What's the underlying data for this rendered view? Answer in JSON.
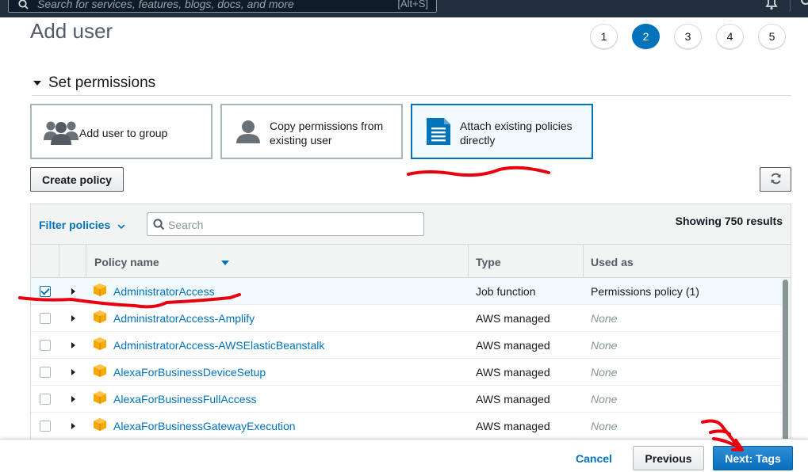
{
  "topbar": {
    "search_placeholder": "Search for services, features, blogs, docs, and more",
    "search_shortcut": "[Alt+S]"
  },
  "page": {
    "title": "Add user",
    "steps": [
      "1",
      "2",
      "3",
      "4",
      "5"
    ],
    "active_step": "2"
  },
  "permissions": {
    "section_title": "Set permissions",
    "options": [
      {
        "label": "Add user to group",
        "icon": "group-icon",
        "selected": false
      },
      {
        "label": "Copy permissions from existing user",
        "icon": "user-icon",
        "selected": false
      },
      {
        "label": "Attach existing policies directly",
        "icon": "document-icon",
        "selected": true
      }
    ]
  },
  "toolbar": {
    "create_policy_label": "Create policy",
    "refresh_icon": "refresh-icon"
  },
  "table": {
    "filter_label": "Filter policies",
    "search_placeholder": "Search",
    "results_count": "Showing 750 results",
    "columns": {
      "name": "Policy name",
      "type": "Type",
      "used_as": "Used as"
    },
    "rows": [
      {
        "name": "AdministratorAccess",
        "type": "Job function",
        "used_as": "Permissions policy (1)",
        "checked": true
      },
      {
        "name": "AdministratorAccess-Amplify",
        "type": "AWS managed",
        "used_as": "None",
        "checked": false
      },
      {
        "name": "AdministratorAccess-AWSElasticBeanstalk",
        "type": "AWS managed",
        "used_as": "None",
        "checked": false
      },
      {
        "name": "AlexaForBusinessDeviceSetup",
        "type": "AWS managed",
        "used_as": "None",
        "checked": false
      },
      {
        "name": "AlexaForBusinessFullAccess",
        "type": "AWS managed",
        "used_as": "None",
        "checked": false
      },
      {
        "name": "AlexaForBusinessGatewayExecution",
        "type": "AWS managed",
        "used_as": "None",
        "checked": false
      }
    ]
  },
  "footer": {
    "cancel_label": "Cancel",
    "previous_label": "Previous",
    "next_label": "Next: Tags"
  },
  "colors": {
    "nav_bg": "#232f3e",
    "link_blue": "#0073bb",
    "policy_icon_orange": "#f7a800",
    "annotation_red": "#e8000f"
  }
}
